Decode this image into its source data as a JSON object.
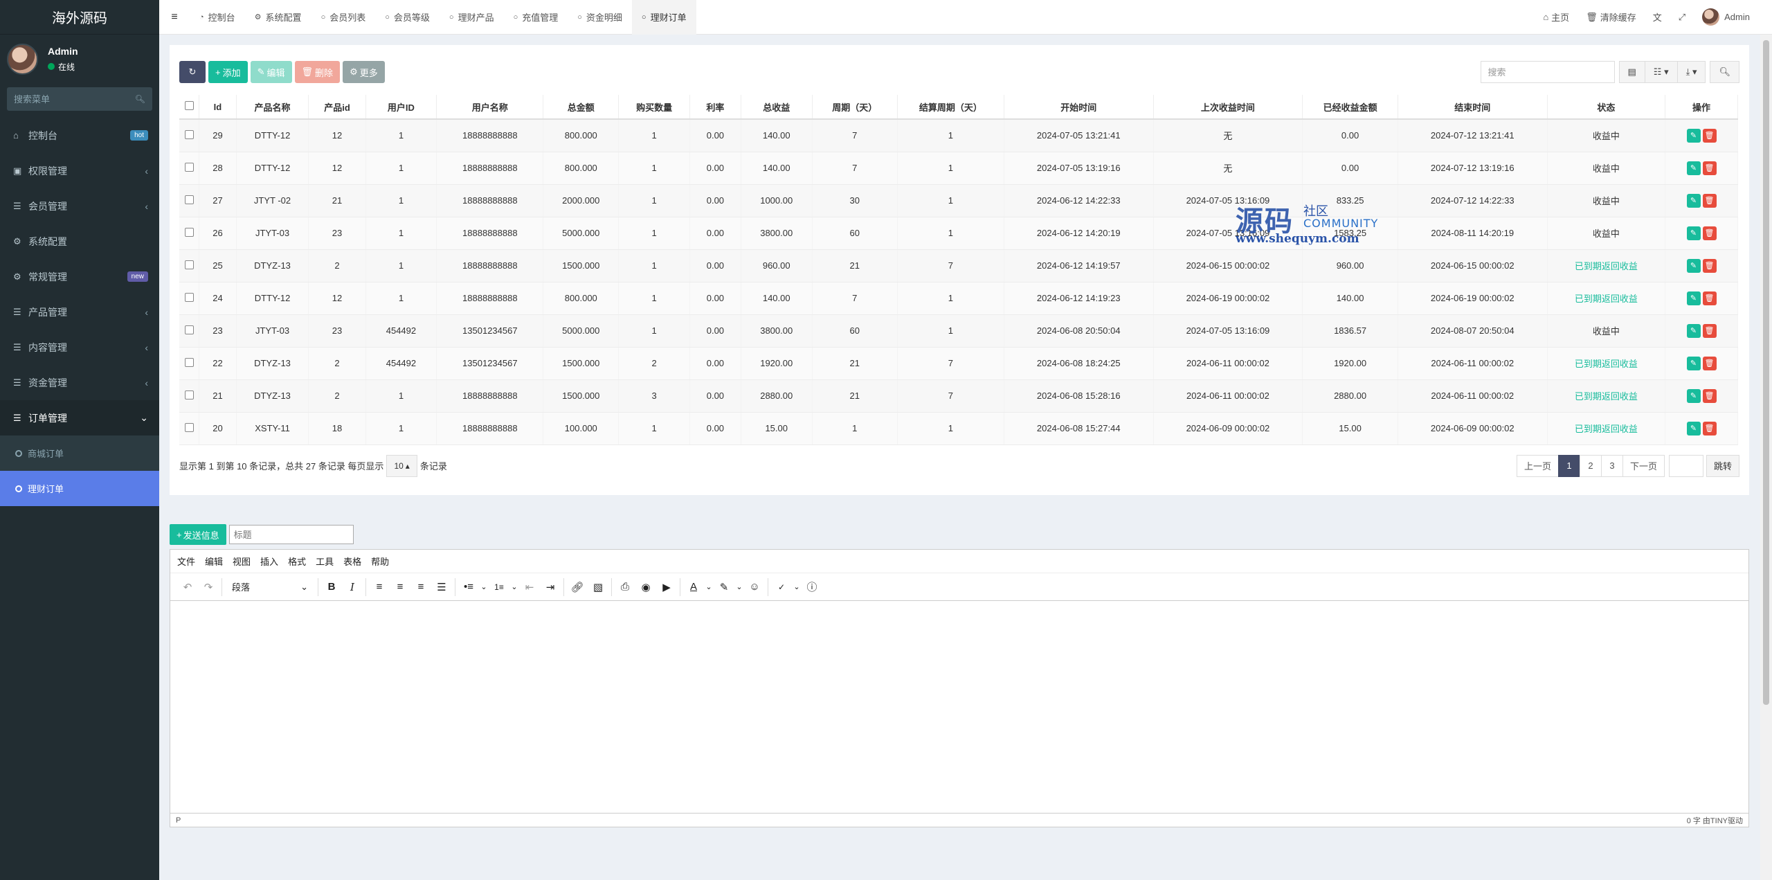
{
  "sidebar": {
    "logo": "海外源码",
    "user": {
      "name": "Admin",
      "status": "在线"
    },
    "search_placeholder": "搜索菜单",
    "menu": [
      {
        "label": "控制台",
        "icon": "home-icon",
        "badge": "hot"
      },
      {
        "label": "权限管理",
        "icon": "users-icon"
      },
      {
        "label": "会员管理",
        "icon": "list-icon"
      },
      {
        "label": "系统配置",
        "icon": "gear-icon"
      },
      {
        "label": "常规管理",
        "icon": "cogs-icon",
        "badge": "new"
      },
      {
        "label": "产品管理",
        "icon": "list-icon"
      },
      {
        "label": "内容管理",
        "icon": "list-icon"
      },
      {
        "label": "资金管理",
        "icon": "list-icon"
      },
      {
        "label": "订单管理",
        "icon": "list-icon",
        "open": true
      }
    ],
    "submenu": [
      {
        "label": "商城订单"
      },
      {
        "label": "理财订单",
        "active": true
      }
    ]
  },
  "topnav": {
    "tabs": [
      "控制台",
      "系统配置",
      "会员列表",
      "会员等级",
      "理财产品",
      "充值管理",
      "资金明细",
      "理财订单"
    ],
    "active_tab": "理财订单",
    "right": {
      "home": "主页",
      "clear_cache": "清除缓存",
      "admin": "Admin"
    }
  },
  "toolbar": {
    "add": "添加",
    "edit": "编辑",
    "delete": "删除",
    "more": "更多",
    "search_placeholder": "搜索"
  },
  "table": {
    "headers": [
      "Id",
      "产品名称",
      "产品id",
      "用户ID",
      "用户名称",
      "总金额",
      "购买数量",
      "利率",
      "总收益",
      "周期（天）",
      "结算周期（天）",
      "开始时间",
      "上次收益时间",
      "已经收益金额",
      "结束时间",
      "状态",
      "操作"
    ],
    "rows": [
      [
        "29",
        "DTTY-12",
        "12",
        "1",
        "18888888888",
        "800.000",
        "1",
        "0.00",
        "140.00",
        "7",
        "1",
        "2024-07-05 13:21:41",
        "无",
        "0.00",
        "2024-07-12 13:21:41",
        "收益中"
      ],
      [
        "28",
        "DTTY-12",
        "12",
        "1",
        "18888888888",
        "800.000",
        "1",
        "0.00",
        "140.00",
        "7",
        "1",
        "2024-07-05 13:19:16",
        "无",
        "0.00",
        "2024-07-12 13:19:16",
        "收益中"
      ],
      [
        "27",
        "JTYT -02",
        "21",
        "1",
        "18888888888",
        "2000.000",
        "1",
        "0.00",
        "1000.00",
        "30",
        "1",
        "2024-06-12 14:22:33",
        "2024-07-05 13:16:09",
        "833.25",
        "2024-07-12 14:22:33",
        "收益中"
      ],
      [
        "26",
        "JTYT-03",
        "23",
        "1",
        "18888888888",
        "5000.000",
        "1",
        "0.00",
        "3800.00",
        "60",
        "1",
        "2024-06-12 14:20:19",
        "2024-07-05 13:16:09",
        "1583.25",
        "2024-08-11 14:20:19",
        "收益中"
      ],
      [
        "25",
        "DTYZ-13",
        "2",
        "1",
        "18888888888",
        "1500.000",
        "1",
        "0.00",
        "960.00",
        "21",
        "7",
        "2024-06-12 14:19:57",
        "2024-06-15 00:00:02",
        "960.00",
        "2024-06-15 00:00:02",
        "已到期返回收益"
      ],
      [
        "24",
        "DTTY-12",
        "12",
        "1",
        "18888888888",
        "800.000",
        "1",
        "0.00",
        "140.00",
        "7",
        "1",
        "2024-06-12 14:19:23",
        "2024-06-19 00:00:02",
        "140.00",
        "2024-06-19 00:00:02",
        "已到期返回收益"
      ],
      [
        "23",
        "JTYT-03",
        "23",
        "454492",
        "13501234567",
        "5000.000",
        "1",
        "0.00",
        "3800.00",
        "60",
        "1",
        "2024-06-08 20:50:04",
        "2024-07-05 13:16:09",
        "1836.57",
        "2024-08-07 20:50:04",
        "收益中"
      ],
      [
        "22",
        "DTYZ-13",
        "2",
        "454492",
        "13501234567",
        "1500.000",
        "2",
        "0.00",
        "1920.00",
        "21",
        "7",
        "2024-06-08 18:24:25",
        "2024-06-11 00:00:02",
        "1920.00",
        "2024-06-11 00:00:02",
        "已到期返回收益"
      ],
      [
        "21",
        "DTYZ-13",
        "2",
        "1",
        "18888888888",
        "1500.000",
        "3",
        "0.00",
        "2880.00",
        "21",
        "7",
        "2024-06-08 15:28:16",
        "2024-06-11 00:00:02",
        "2880.00",
        "2024-06-11 00:00:02",
        "已到期返回收益"
      ],
      [
        "20",
        "XSTY-11",
        "18",
        "1",
        "18888888888",
        "100.000",
        "1",
        "0.00",
        "15.00",
        "1",
        "1",
        "2024-06-08 15:27:44",
        "2024-06-09 00:00:02",
        "15.00",
        "2024-06-09 00:00:02",
        "已到期返回收益"
      ]
    ]
  },
  "pagination": {
    "summary_prefix": "显示第 1 到第 10 条记录，总共 27 条记录 每页显示",
    "page_size": "10",
    "summary_suffix": "条记录",
    "prev": "上一页",
    "pages": [
      "1",
      "2",
      "3"
    ],
    "next": "下一页",
    "go": "跳转"
  },
  "watermark": {
    "big": "源码",
    "small1": "社区",
    "small2": "COMMUNITY",
    "url": "www.shequym.com"
  },
  "editor": {
    "send_button": "发送信息",
    "title_placeholder": "标题",
    "menubar": [
      "文件",
      "编辑",
      "视图",
      "插入",
      "格式",
      "工具",
      "表格",
      "帮助"
    ],
    "block_format": "段落",
    "status_left": "P",
    "status_right": "0 字  由TINY驱动"
  },
  "colors": {
    "sidebar_bg": "#222d32",
    "accent_green": "#18bc9c",
    "accent_dark": "#444c69",
    "danger": "#e74c3c",
    "active_sub": "#5a7de8"
  }
}
